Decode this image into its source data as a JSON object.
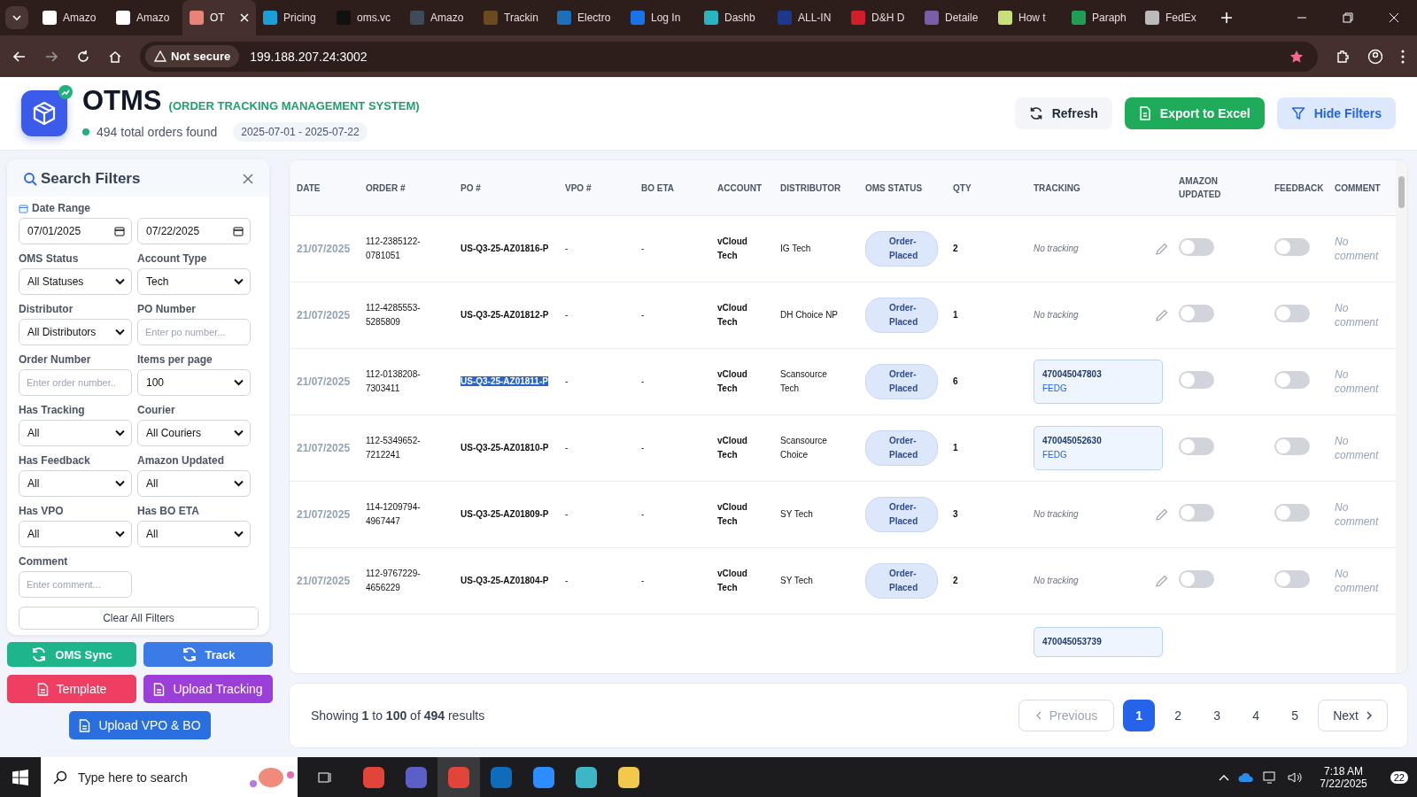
{
  "browser": {
    "tabs": [
      {
        "title": "Amazo",
        "selected": false,
        "color": "#ffffff"
      },
      {
        "title": "Amazo",
        "selected": false,
        "color": "#ffffff"
      },
      {
        "title": "OT",
        "selected": true,
        "color": "#e8837a"
      },
      {
        "title": "Pricing",
        "selected": false,
        "color": "#1a9fd8"
      },
      {
        "title": "oms.vc",
        "selected": false,
        "color": "#111111"
      },
      {
        "title": "Amazo",
        "selected": false,
        "color": "#3f4b5a"
      },
      {
        "title": "Trackin",
        "selected": false,
        "color": "#6b4a1f"
      },
      {
        "title": "Electro",
        "selected": false,
        "color": "#1d6fb8"
      },
      {
        "title": "Log In",
        "selected": false,
        "color": "#1a73e8"
      },
      {
        "title": "Dashb",
        "selected": false,
        "color": "#2bb3c0"
      },
      {
        "title": "ALL-IN",
        "selected": false,
        "color": "#1b3a8c"
      },
      {
        "title": "D&H D",
        "selected": false,
        "color": "#d01f2b"
      },
      {
        "title": "Detaile",
        "selected": false,
        "color": "#7a5fa8"
      },
      {
        "title": "How t",
        "selected": false,
        "color": "#c8e07a"
      },
      {
        "title": "Paraph",
        "selected": false,
        "color": "#1f9d55"
      },
      {
        "title": "FedEx",
        "selected": false,
        "color": "#bbbbbb"
      }
    ],
    "security": "Not secure",
    "address": "199.188.207.24:3002"
  },
  "header": {
    "title": "OTMS",
    "subtitle": "(ORDER TRACKING MANAGEMENT SYSTEM)",
    "count": "494 total orders found",
    "date_range": "2025-07-01 - 2025-07-22",
    "buttons": [
      {
        "label": "Refresh",
        "kind": "refresh"
      },
      {
        "label": "Export to Excel",
        "kind": "export"
      },
      {
        "label": "Hide Filters",
        "kind": "filter"
      }
    ]
  },
  "filters": {
    "title": "Search Filters",
    "date_range": {
      "label": "Date Range",
      "from": "07/01/2025",
      "to": "07/22/2025"
    },
    "fields": [
      {
        "label": "OMS Status",
        "kind": "select",
        "value": "All Statuses"
      },
      {
        "label": "Account Type",
        "kind": "select",
        "value": "Tech"
      },
      {
        "label": "Distributor",
        "kind": "select",
        "value": "All Distributors"
      },
      {
        "label": "PO Number",
        "kind": "text",
        "placeholder": "Enter po number..."
      },
      {
        "label": "Order Number",
        "kind": "text",
        "placeholder": "Enter order number.."
      },
      {
        "label": "Items per page",
        "kind": "select",
        "value": "100"
      },
      {
        "label": "Has Tracking",
        "kind": "select",
        "value": "All"
      },
      {
        "label": "Courier",
        "kind": "select",
        "value": "All Couriers"
      },
      {
        "label": "Has Feedback",
        "kind": "select",
        "value": "All"
      },
      {
        "label": "Amazon Updated",
        "kind": "select",
        "value": "All"
      },
      {
        "label": "Has VPO",
        "kind": "select",
        "value": "All"
      },
      {
        "label": "Has BO ETA",
        "kind": "select",
        "value": "All"
      },
      {
        "label": "Comment",
        "kind": "text",
        "placeholder": "Enter comment..."
      }
    ],
    "clear_button": "Clear All Filters"
  },
  "actions": [
    {
      "label": "OMS Sync",
      "kind": "sync",
      "color": "#1fb58a"
    },
    {
      "label": "Track",
      "kind": "sync",
      "color": "#3b7be8"
    },
    {
      "label": "Template",
      "kind": "file",
      "color": "#ee3f62"
    },
    {
      "label": "Upload Tracking",
      "kind": "file",
      "color": "#9b3fd8"
    },
    {
      "label": "Upload VPO & BO",
      "kind": "file",
      "color": "#2a6fe0"
    }
  ],
  "table": {
    "columns": [
      "DATE",
      "ORDER #",
      "PO #",
      "VPO #",
      "BO ETA",
      "ACCOUNT",
      "DISTRIBUTOR",
      "OMS STATUS",
      "QTY",
      "TRACKING",
      "AMAZON UPDATED",
      "FEEDBACK",
      "COMMENT"
    ],
    "rows": [
      {
        "date": "21/07/2025",
        "order": "112-2385122-0781051",
        "po": "US-Q3-25-AZ01816-P",
        "po_selected": false,
        "vpo": "-",
        "bo_eta": "-",
        "account": "vCloud Tech",
        "distributor": "IG Tech",
        "status": "Order-Placed",
        "qty": "2",
        "tracking": null,
        "no_tracking": "No tracking",
        "amazon_updated": false,
        "feedback": false,
        "comment": "No comment"
      },
      {
        "date": "21/07/2025",
        "order": "112-4285553-5285809",
        "po": "US-Q3-25-AZ01812-P",
        "po_selected": false,
        "vpo": "-",
        "bo_eta": "-",
        "account": "vCloud Tech",
        "distributor": "DH Choice NP",
        "status": "Order-Placed",
        "qty": "1",
        "tracking": null,
        "no_tracking": "No tracking",
        "amazon_updated": false,
        "feedback": false,
        "comment": "No comment"
      },
      {
        "date": "21/07/2025",
        "order": "112-0138208-7303411",
        "po": "US-Q3-25-AZ01811-P",
        "po_selected": true,
        "vpo": "-",
        "bo_eta": "-",
        "account": "vCloud Tech",
        "distributor": "Scansource Tech",
        "status": "Order-Placed",
        "qty": "6",
        "tracking": {
          "number": "470045047803",
          "courier": "FEDG"
        },
        "amazon_updated": false,
        "feedback": false,
        "comment": "No comment"
      },
      {
        "date": "21/07/2025",
        "order": "112-5349652-7212241",
        "po": "US-Q3-25-AZ01810-P",
        "po_selected": false,
        "vpo": "-",
        "bo_eta": "-",
        "account": "vCloud Tech",
        "distributor": "Scansource Choice",
        "status": "Order-Placed",
        "qty": "1",
        "tracking": {
          "number": "470045052630",
          "courier": "FEDG"
        },
        "amazon_updated": false,
        "feedback": false,
        "comment": "No comment"
      },
      {
        "date": "21/07/2025",
        "order": "114-1209794-4967447",
        "po": "US-Q3-25-AZ01809-P",
        "po_selected": false,
        "vpo": "-",
        "bo_eta": "-",
        "account": "vCloud Tech",
        "distributor": "SY Tech",
        "status": "Order-Placed",
        "qty": "3",
        "tracking": null,
        "no_tracking": "No tracking",
        "amazon_updated": false,
        "feedback": false,
        "comment": "No comment"
      },
      {
        "date": "21/07/2025",
        "order": "112-9767229-4656229",
        "po": "US-Q3-25-AZ01804-P",
        "po_selected": false,
        "vpo": "-",
        "bo_eta": "-",
        "account": "vCloud Tech",
        "distributor": "SY Tech",
        "status": "Order-Placed",
        "qty": "2",
        "tracking": null,
        "no_tracking": "No tracking",
        "amazon_updated": false,
        "feedback": false,
        "comment": "No comment"
      }
    ],
    "partial_row": {
      "tracking": "470045053739"
    }
  },
  "pagination": {
    "summary": "Showing **1** to **100** of **494** results",
    "previous": "Previous",
    "next": "Next",
    "pages": [
      {
        "label": "1",
        "selected": true
      },
      {
        "label": "2",
        "selected": false
      },
      {
        "label": "3",
        "selected": false
      },
      {
        "label": "4",
        "selected": false
      },
      {
        "label": "5",
        "selected": false
      }
    ]
  },
  "taskbar": {
    "search_placeholder": "Type here to search",
    "apps": [
      {
        "color": "#e3443a"
      },
      {
        "color": "#5b5fc7"
      },
      {
        "color": "#e3443a"
      },
      {
        "color": "#0f6cbd"
      },
      {
        "color": "#2d8cff"
      },
      {
        "color": "#3fb6c6"
      },
      {
        "color": "#f2c94c"
      }
    ],
    "time": "7:18 AM",
    "date": "7/22/2025",
    "notifications": "22"
  }
}
